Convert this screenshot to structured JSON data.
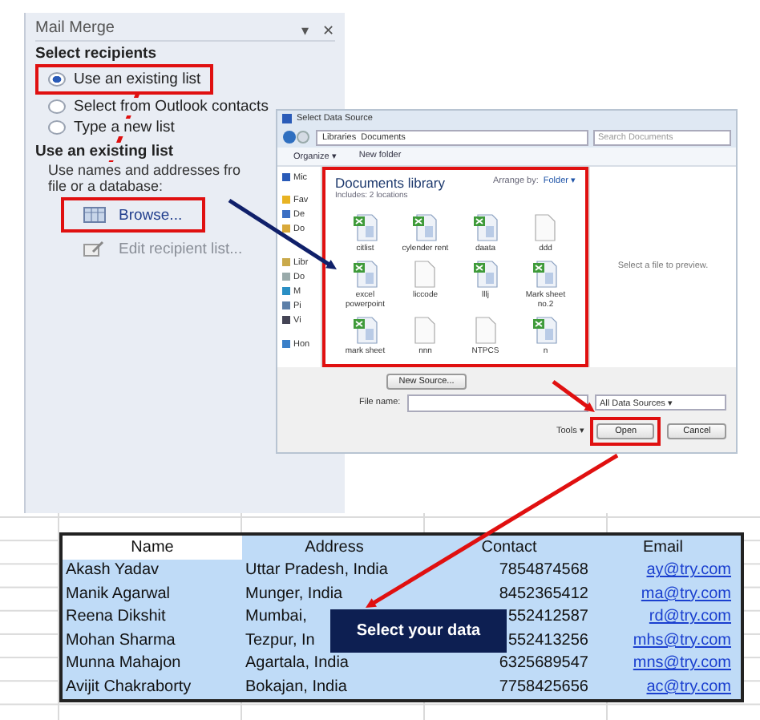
{
  "mail_merge": {
    "title": "Mail Merge",
    "menu_glyph": "▾",
    "close_glyph": "✕",
    "select_heading": "Select recipients",
    "options": [
      {
        "label": "Use an existing list",
        "selected": true
      },
      {
        "label": "Select from Outlook contacts",
        "selected": false
      },
      {
        "label": "Type a new list",
        "selected": false
      }
    ],
    "list_heading": "Use an existing list",
    "description": "Use names and addresses fro",
    "description_2": "file or a database:",
    "actions": [
      {
        "label": "Browse...",
        "kind": "browse",
        "disabled": false
      },
      {
        "label": "Edit recipient list...",
        "kind": "edit",
        "disabled": true
      }
    ]
  },
  "dialog": {
    "title": "Select Data Source",
    "path": [
      "Libraries",
      "Documents"
    ],
    "search": {
      "placeholder": "Search Documents"
    },
    "toolbar": [
      "Organize ▾",
      "New folder"
    ],
    "nav": [
      {
        "label": "Mic",
        "kind": "app"
      },
      {
        "label": "Fav",
        "kind": "star"
      },
      {
        "label": "De",
        "kind": "desktop"
      },
      {
        "label": "Do",
        "kind": "folder"
      },
      {
        "label": "Libr",
        "kind": "library"
      },
      {
        "label": "Do",
        "kind": "doc"
      },
      {
        "label": "M",
        "kind": "music"
      },
      {
        "label": "Pi",
        "kind": "pictures"
      },
      {
        "label": "Vi",
        "kind": "video"
      },
      {
        "label": "Hon",
        "kind": "network"
      }
    ],
    "library": {
      "title": "Documents library",
      "includes": "Includes: 2 locations",
      "arrange_label": "Arrange by:",
      "arrange_value": "Folder ▾",
      "files": [
        {
          "name": "citlist",
          "kind": "excel"
        },
        {
          "name": "cylender rent",
          "kind": "excel"
        },
        {
          "name": "daata",
          "kind": "excel"
        },
        {
          "name": "ddd",
          "kind": "blank"
        },
        {
          "name": "excel powerpoint",
          "kind": "excel"
        },
        {
          "name": "liccode",
          "kind": "blank"
        },
        {
          "name": "lllj",
          "kind": "excel"
        },
        {
          "name": "Mark sheet no.2",
          "kind": "excel"
        },
        {
          "name": "mark sheet",
          "kind": "excel"
        },
        {
          "name": "nnn",
          "kind": "blank"
        },
        {
          "name": "NTPCS",
          "kind": "blank"
        },
        {
          "name": "n",
          "kind": "excel"
        }
      ]
    },
    "preview_text": "Select a file to preview.",
    "new_source": "New Source...",
    "file_name_label": "File name:",
    "filter": "All Data Sources ▾",
    "tools": "Tools ▾",
    "open": "Open",
    "cancel": "Cancel"
  },
  "sheet": {
    "columns": [
      "Name",
      "Address",
      "Contact",
      "Email"
    ],
    "rows": [
      {
        "cells": [
          "Akash Yadav",
          "Uttar Pradesh, India",
          "7854874568",
          "ay@try.com"
        ]
      },
      {
        "cells": [
          "Manik Agarwal",
          "Munger, India",
          "8452365412",
          "ma@try.com"
        ]
      },
      {
        "cells": [
          "Reena Dikshit",
          "Mumbai,",
          "552412587",
          "rd@try.com"
        ]
      },
      {
        "cells": [
          "Mohan Sharma",
          "Tezpur, In",
          "552413256",
          "mhs@try.com"
        ]
      },
      {
        "cells": [
          "Munna Mahajon",
          "Agartala, India",
          "6325689547",
          "mns@try.com"
        ]
      },
      {
        "cells": [
          "Avijit Chakraborty",
          "Bokajan, India",
          "7758425656",
          "ac@try.com"
        ]
      }
    ],
    "callout": "Select your data"
  }
}
